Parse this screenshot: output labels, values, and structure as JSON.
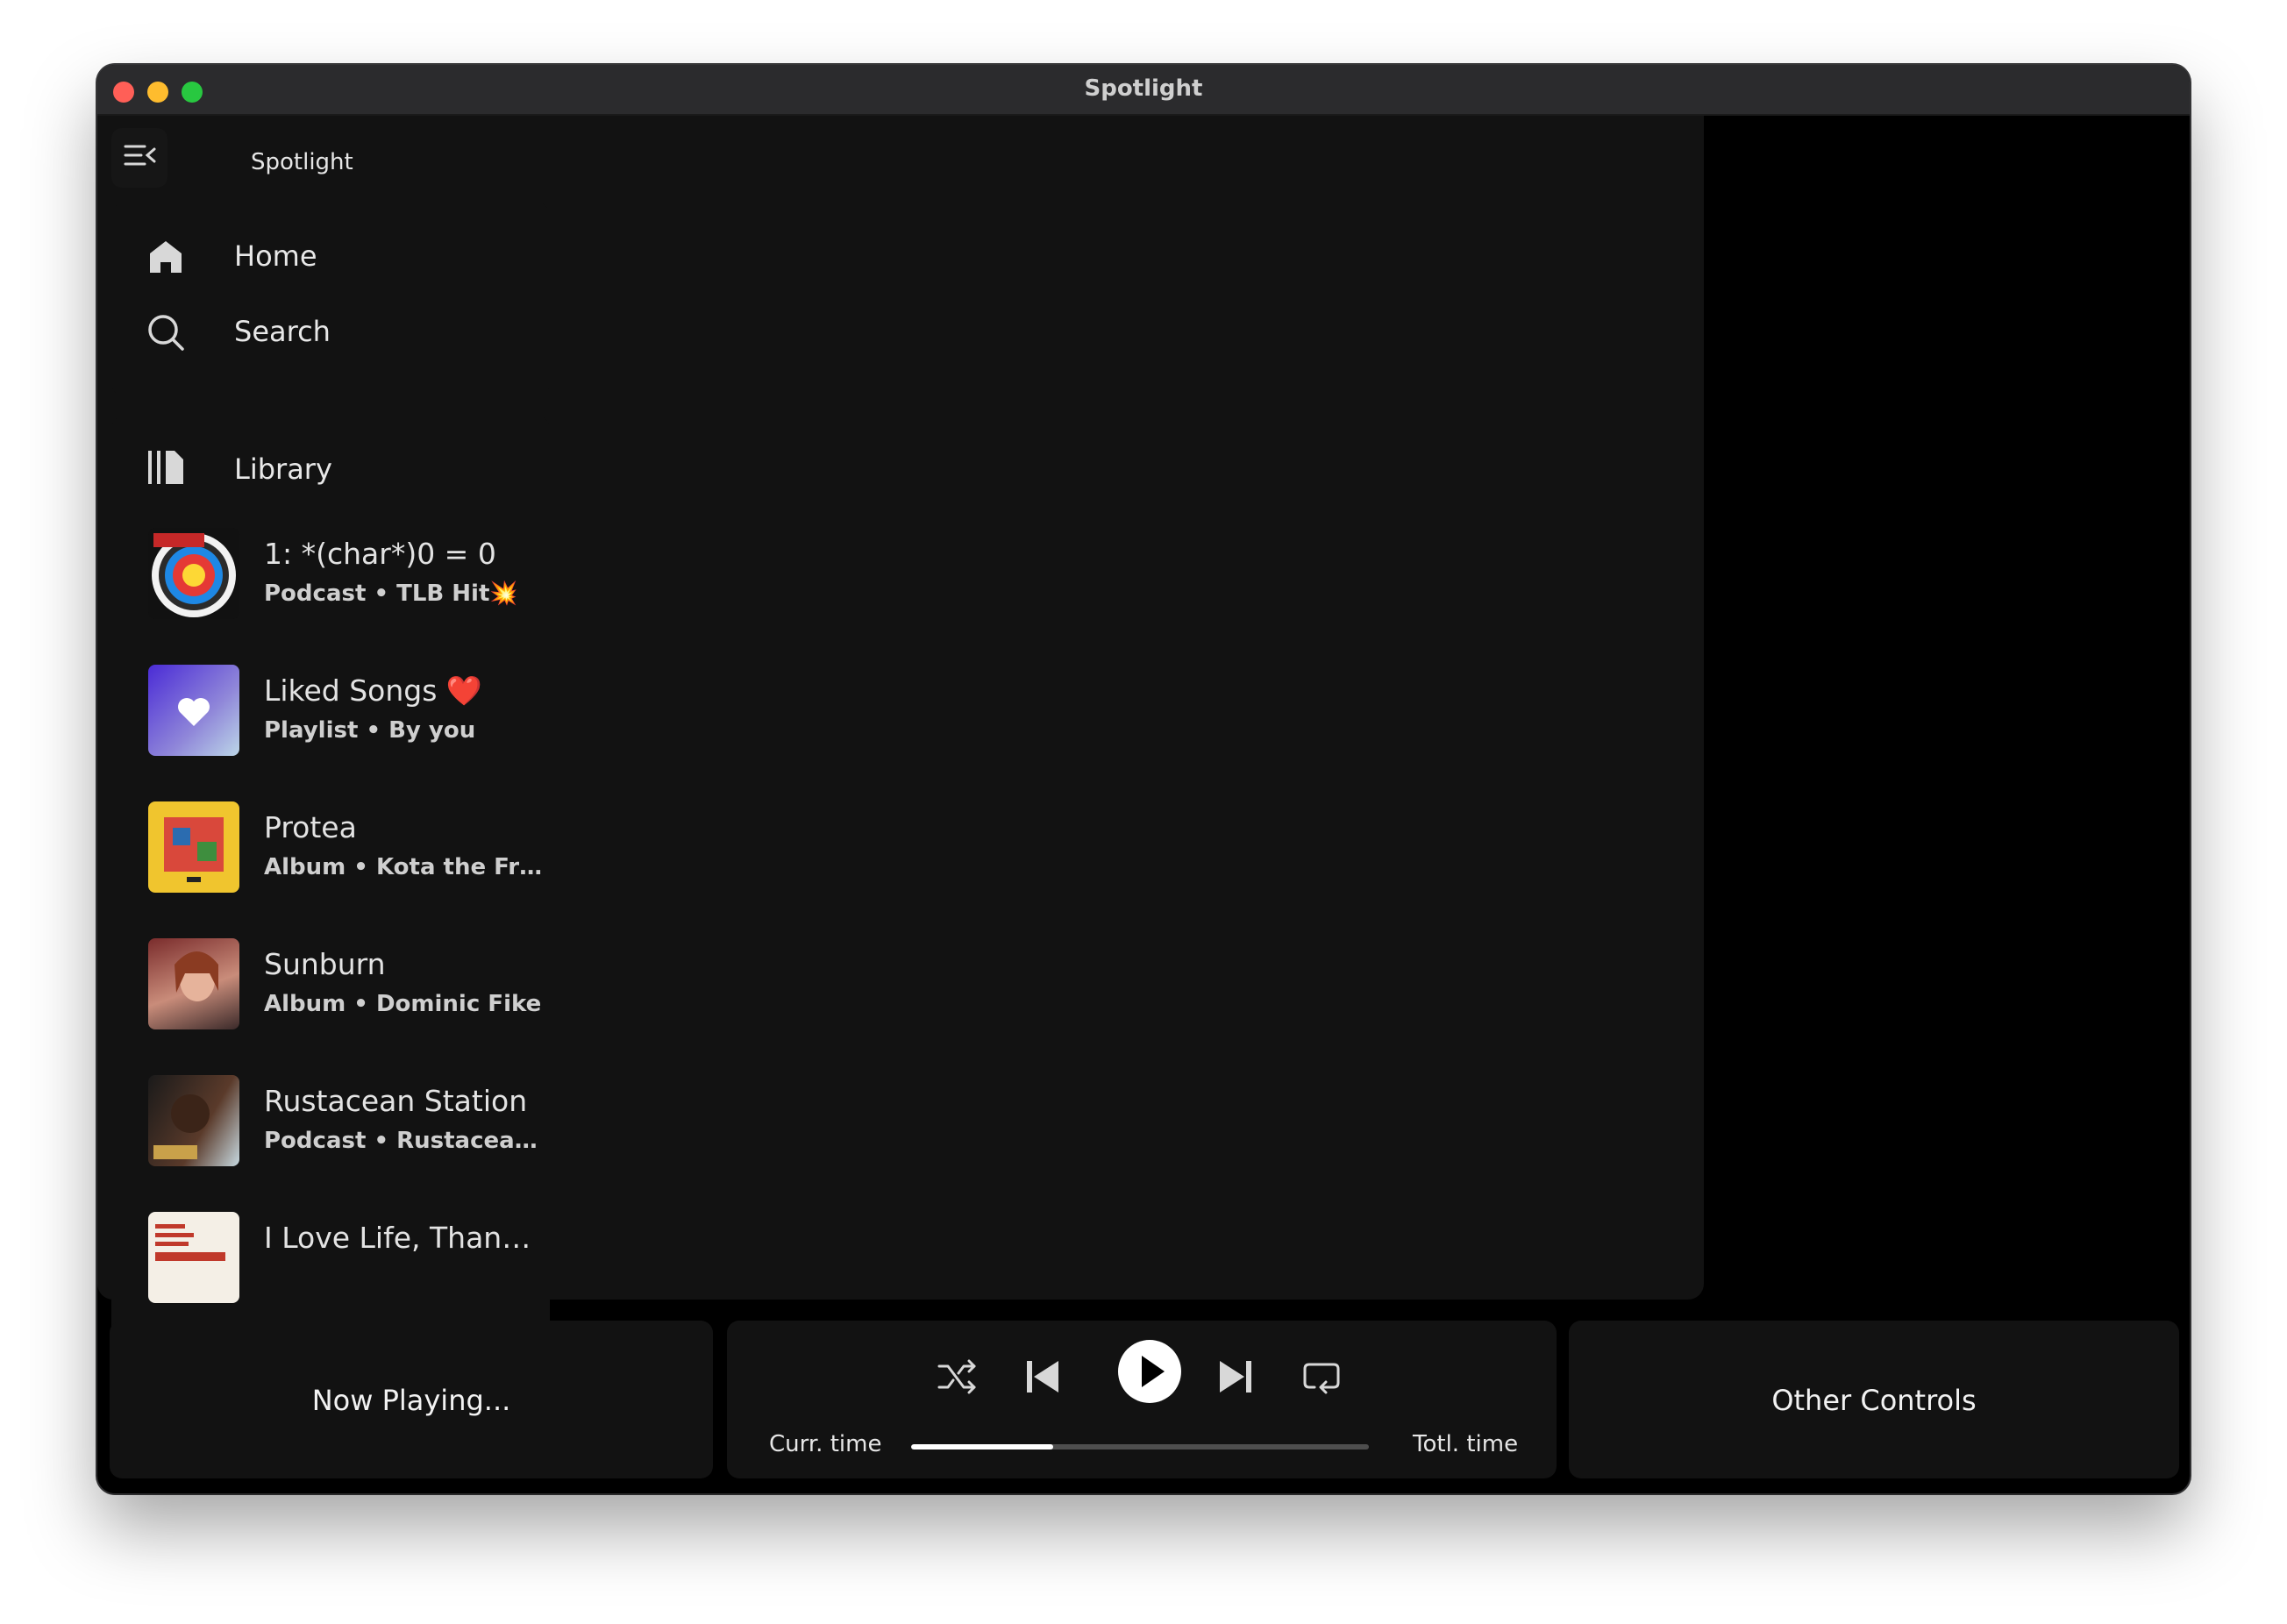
{
  "window": {
    "title": "Spotlight"
  },
  "sidebar": {
    "title": "Spotlight",
    "toggle_icon": "sidebar-collapse-icon",
    "nav": [
      {
        "label": "Home",
        "icon": "home-icon"
      },
      {
        "label": "Search",
        "icon": "search-icon"
      }
    ],
    "library": {
      "label": "Library",
      "icon": "library-icon",
      "items": [
        {
          "name": "1: *(char*)0 = 0",
          "subtitle": "Podcast • TLB Hit💥",
          "art": "target-art"
        },
        {
          "name": "Liked Songs ❤️",
          "subtitle": "Playlist • By you",
          "art": "liked-songs-art"
        },
        {
          "name": "Protea",
          "subtitle": "Album • Kota the Friend",
          "art": "protea-art"
        },
        {
          "name": "Sunburn",
          "subtitle": "Album • Dominic Fike",
          "art": "sunburn-art"
        },
        {
          "name": "Rustacean Station",
          "subtitle": "Podcast • Rustacean St...",
          "art": "rustacean-art"
        },
        {
          "name": "I Love Life, Thank ...",
          "subtitle": "",
          "art": "ilovelife-art"
        }
      ]
    }
  },
  "player": {
    "now_playing": "Now Playing...",
    "current_time": "Curr. time",
    "total_time": "Totl. time",
    "progress": 0.31,
    "other_controls": "Other Controls",
    "controls": [
      "shuffle-icon",
      "previous-icon",
      "play-icon",
      "next-icon",
      "repeat-icon"
    ]
  },
  "colors": {
    "background": "#000000",
    "panel": "#121212",
    "text": "#e8e8e8",
    "accent": "#ffffff"
  }
}
